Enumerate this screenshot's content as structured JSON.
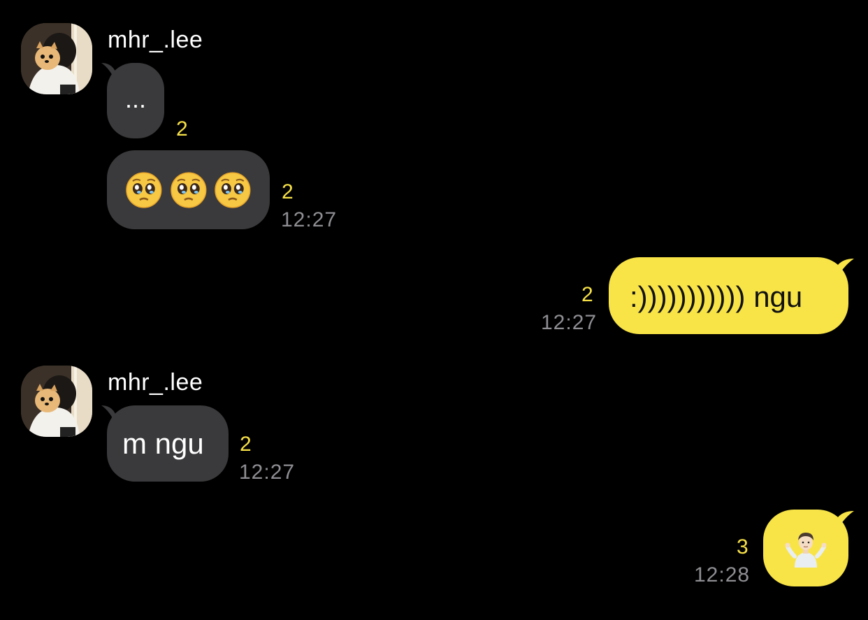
{
  "colors": {
    "background": "#000000",
    "incoming_bubble": "#3a3a3c",
    "outgoing_bubble": "#f8e447",
    "unread_count": "#f6e047",
    "timestamp": "#8e8e93"
  },
  "messages": [
    {
      "sender": "mhr_.lee",
      "avatar": "profile-photo",
      "items": [
        {
          "text": "...",
          "count": "2",
          "time": ""
        },
        {
          "text": "",
          "emoji": [
            "pleading-face-emoji",
            "pleading-face-emoji",
            "pleading-face-emoji"
          ],
          "count": "2",
          "time": "12:27"
        }
      ]
    },
    {
      "sender": "me",
      "items": [
        {
          "text": ":))))))))))) ngu",
          "count": "2",
          "time": "12:27"
        }
      ]
    },
    {
      "sender": "mhr_.lee",
      "avatar": "profile-photo",
      "items": [
        {
          "text": "m ngu",
          "count": "2",
          "time": "12:27"
        }
      ]
    },
    {
      "sender": "me",
      "items": [
        {
          "text": "",
          "emoji": [
            "person-shrugging-emoji"
          ],
          "count": "3",
          "time": "12:28"
        }
      ]
    }
  ]
}
